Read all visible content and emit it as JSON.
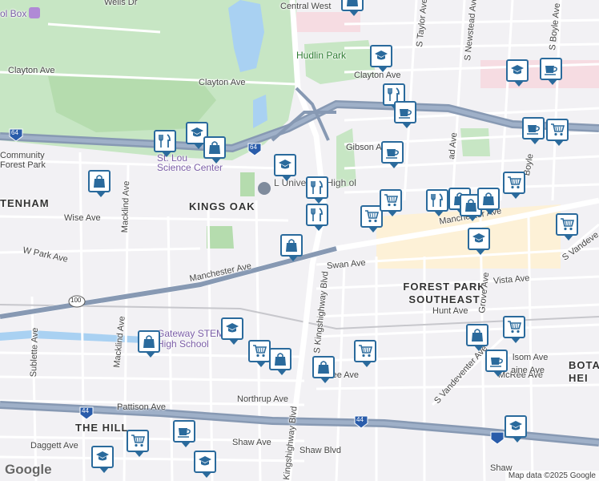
{
  "map": {
    "attribution": "Map data ©2025 Google",
    "logo": "Google",
    "labels": {
      "central_west": "Central West",
      "wells_dr": "Wells Dr",
      "toy_box": "ol Box",
      "hudlin_park": "Hudlin Park",
      "clayton_ave_w": "Clayton Ave",
      "clayton_ave_c": "Clayton Ave",
      "clayton_ave_e": "Clayton Ave",
      "community_forest_park": "Community Forest Park",
      "science_center": "Science Center",
      "st_louis": "St. Lou",
      "university_hs": "L  University High  ol",
      "kings_oak": "KINGS OAK",
      "tenham": "TENHAM",
      "wise_ave": "Wise Ave",
      "mackind_ave": "Macklind Ave",
      "w_park_ave": "W Park Ave",
      "manchester_ave_w": "Manchester Ave",
      "manchester_ave_e": "Manchester Ave",
      "swan_ave": "Swan Ave",
      "kingshighway_n": "S Kingshighway Blvd",
      "forest_park_se": "FOREST PARK SOUTHEAST",
      "vista_ave": "Vista Ave",
      "hunt_ave": "Hunt Ave",
      "gibson_ave": "Gibson Ave",
      "taylor_ave": "S Taylor Ave",
      "newstead_ave": "S Newstead Ave",
      "boyle_ave": "S Boyle Ave",
      "boyle_ave_2": "Boyle",
      "grove_ave": "Grove Ave",
      "vandeventer_ave": "S Vandeventer Ave",
      "vandeventer_ave_2": "S Vandeve",
      "gateway_stem": "Gateway STEM High School",
      "sublette_ave": "Sublette Ave",
      "macklind_ave_s": "Macklind Ave",
      "mcree_ave": "McRee Ave",
      "mcree_ave_e": "McRee Ave",
      "northrup_ave": "Northrup Ave",
      "pattison_ave": "Pattison Ave",
      "the_hill": "THE HILL",
      "shaw_ave": "Shaw Ave",
      "shaw_blvd": "Shaw Blvd",
      "daggett_ave": "Daggett Ave",
      "kingshighway_s": "Kingshighway Blvd",
      "folsom_ave": "lsom Ave",
      "blaine_ave": "aine Ave",
      "bota_hei": "BOTA HEI",
      "rd_ave": "Road Ave",
      "shaw_e": "Shaw",
      "road_ave": "ad Ave",
      "i64_w": "64",
      "i64_c": "64",
      "i44_w": "44",
      "i44_e": "44",
      "us100": "100"
    }
  },
  "pin_types": {
    "school": {
      "icon": "graduation-cap-icon",
      "color": "#2a6a9c"
    },
    "restaurant": {
      "icon": "fork-knife-icon",
      "color": "#2a6a9c"
    },
    "shopping": {
      "icon": "shopping-bag-icon",
      "color": "#2a6a9c"
    },
    "grocery": {
      "icon": "shopping-cart-icon",
      "color": "#2a6a9c"
    },
    "cafe": {
      "icon": "coffee-cup-icon",
      "color": "#2a6a9c"
    }
  },
  "colors": {
    "park": "#c7e6c4",
    "park_dark": "#a8d5a2",
    "water": "#a9d1f2",
    "highway": "#8799b3",
    "road": "#ffffff",
    "commercial": "#fdf1d7",
    "pin": "#2a6a9c"
  }
}
